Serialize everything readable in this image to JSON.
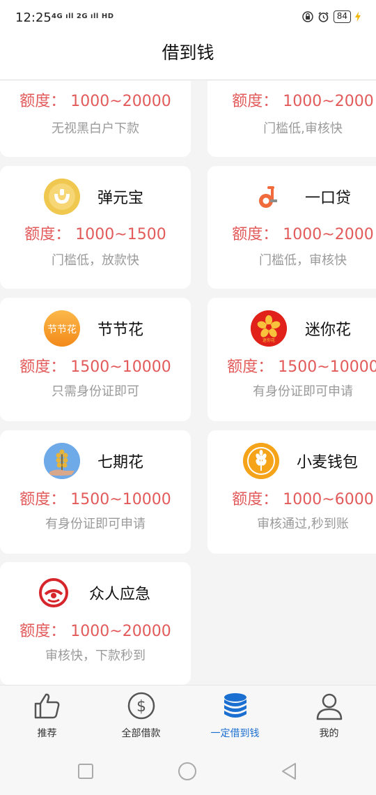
{
  "status": {
    "time": "12:25",
    "network": "4G ıll 2G ıll HD",
    "battery": "84"
  },
  "header": {
    "title": "借到钱"
  },
  "cards": [
    {
      "name": "",
      "amount": "额度： 1000~20000",
      "desc": "无视黑白户下款",
      "icon": "none"
    },
    {
      "name": "",
      "amount": "额度： 1000~2000",
      "desc": "门槛低,审核快",
      "icon": "none"
    },
    {
      "name": "弹元宝",
      "amount": "额度： 1000~1500",
      "desc": "门槛低，放款快",
      "icon": "gold-ingot-icon"
    },
    {
      "name": "一口贷",
      "amount": "额度： 1000~2000",
      "desc": "门槛低，审核快",
      "icon": "d-letter-icon"
    },
    {
      "name": "节节花",
      "amount": "额度： 1500~10000",
      "desc": "只需身份证即可",
      "icon": "jiejiehua-icon",
      "logo_text": "节节花"
    },
    {
      "name": "迷你花",
      "amount": "额度： 1500~10000",
      "desc": "有身份证即可申请",
      "icon": "flower-icon",
      "logo_text": "迷你花"
    },
    {
      "name": "七期花",
      "amount": "额度： 1500~10000",
      "desc": "有身份证即可申请",
      "icon": "plant-icon"
    },
    {
      "name": "小麦钱包",
      "amount": "额度： 1000~6000",
      "desc": "审核通过,秒到账",
      "icon": "wheat-icon"
    },
    {
      "name": "众人应急",
      "amount": "额度： 1000~20000",
      "desc": "审核快，下款秒到",
      "icon": "red-ring-icon"
    }
  ],
  "tabs": [
    {
      "label": "推荐",
      "icon": "thumbs-up-icon",
      "active": false
    },
    {
      "label": "全部借款",
      "icon": "dollar-circle-icon",
      "active": false
    },
    {
      "label": "一定借到钱",
      "icon": "coin-stack-icon",
      "active": true
    },
    {
      "label": "我的",
      "icon": "user-icon",
      "active": false
    }
  ],
  "colors": {
    "amount": "#e35a5a",
    "accent": "#1a6fd1",
    "desc": "#9a9a9a"
  }
}
